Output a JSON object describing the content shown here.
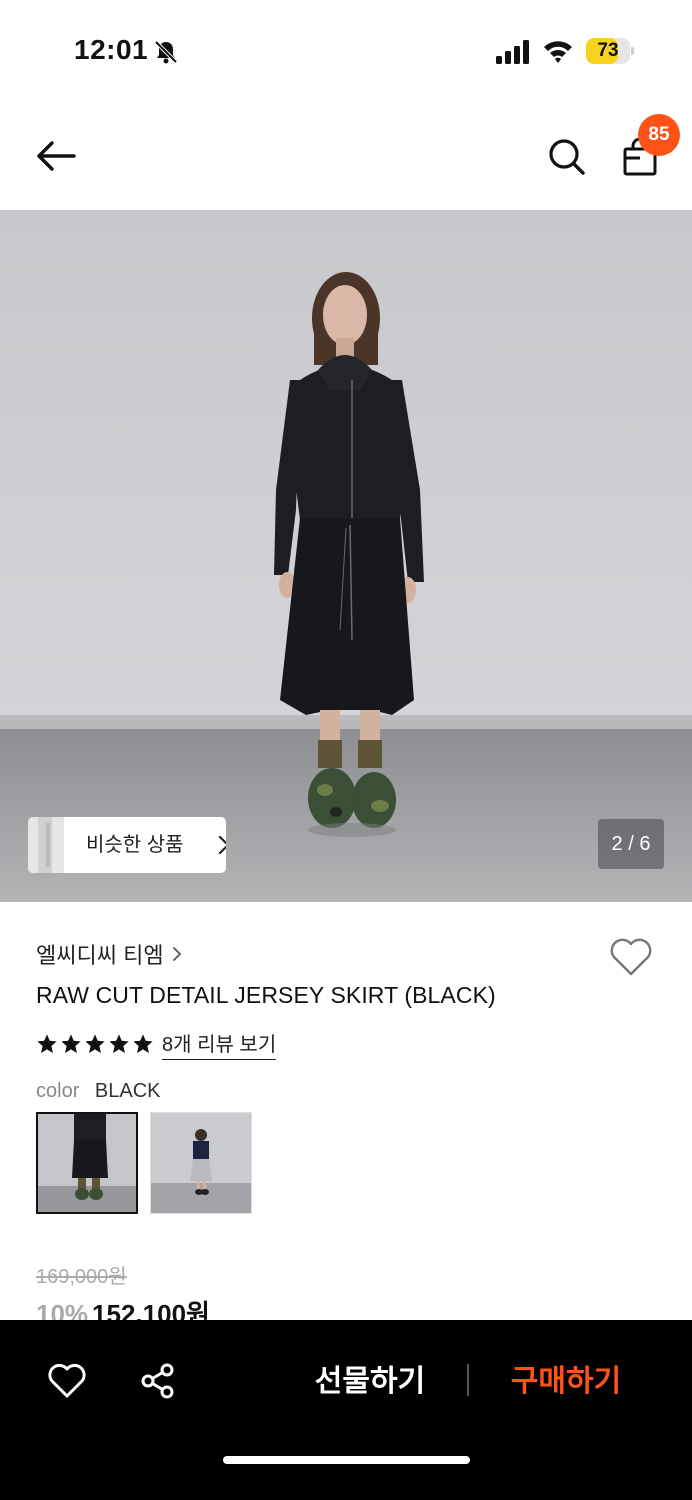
{
  "status_bar": {
    "time": "12:01",
    "battery": "73",
    "battery_level": 0.73,
    "icons": [
      "bell-slash-icon",
      "signal-icon",
      "wifi-icon",
      "battery-icon"
    ]
  },
  "header": {
    "back_icon": "arrow-left-icon",
    "search_icon": "search-icon",
    "bag_icon": "shopping-bag-icon",
    "cart_count": "85"
  },
  "gallery": {
    "similar_label": "비슷한 상품",
    "page_indicator": "2 / 6"
  },
  "product": {
    "brand": "엘씨디씨 티엠",
    "name": "RAW CUT DETAIL JERSEY SKIRT (BLACK)",
    "rating_stars": 5,
    "review_link": "8개 리뷰 보기",
    "color_label": "color",
    "color_value": "BLACK",
    "original_price": "169,000원",
    "discount_rate": "10%",
    "sale_price": "152,100원"
  },
  "bottom_bar": {
    "gift_label": "선물하기",
    "buy_label": "구매하기"
  },
  "colors": {
    "accent": "#ff5216",
    "battery_fill": "#f7d31d",
    "bottom_bar_bg": "#000000"
  }
}
